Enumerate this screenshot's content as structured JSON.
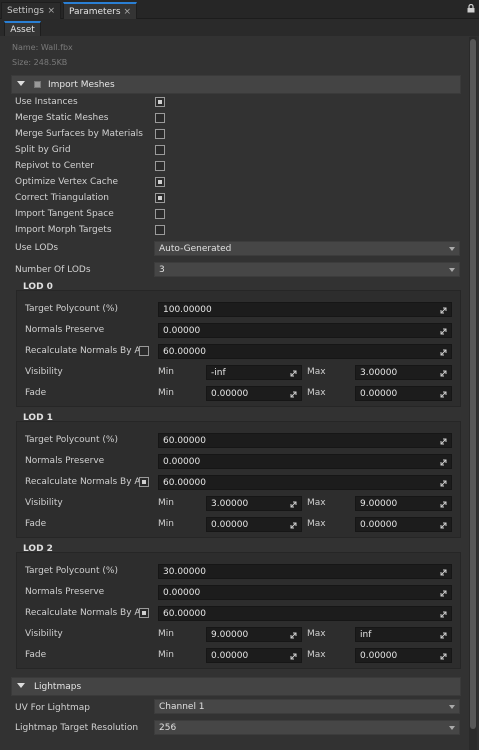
{
  "tabs": [
    {
      "label": "Settings",
      "close": "×"
    },
    {
      "label": "Parameters",
      "close": "×"
    }
  ],
  "subtab": "Asset",
  "asset": {
    "name": "Name: Wall.fbx",
    "size": "Size: 248.5KB"
  },
  "import_meshes": {
    "title": "Import Meshes",
    "options": [
      {
        "label": "Use Instances",
        "checked": true
      },
      {
        "label": "Merge Static Meshes",
        "checked": false
      },
      {
        "label": "Merge Surfaces by Materials",
        "checked": false
      },
      {
        "label": "Split by Grid",
        "checked": false
      },
      {
        "label": "Repivot to Center",
        "checked": false
      },
      {
        "label": "Optimize Vertex Cache",
        "checked": true
      },
      {
        "label": "Correct Triangulation",
        "checked": true
      },
      {
        "label": "Import Tangent Space",
        "checked": false
      },
      {
        "label": "Import Morph Targets",
        "checked": false
      }
    ],
    "use_lods": {
      "label": "Use LODs",
      "value": "Auto-Generated"
    },
    "num_lods": {
      "label": "Number Of LODs",
      "value": "3"
    }
  },
  "lod_labels": {
    "target": "Target Polycount (%)",
    "normals": "Normals Preserve",
    "recalc": "Recalculate Normals By A...",
    "visibility": "Visibility",
    "fade": "Fade",
    "min": "Min",
    "max": "Max"
  },
  "lods": [
    {
      "title": "LOD 0",
      "target": "100.00000",
      "normals": "0.00000",
      "recalc_checked": false,
      "recalc": "60.00000",
      "vis_min": "-inf",
      "vis_max": "3.00000",
      "fade_min": "0.00000",
      "fade_max": "0.00000"
    },
    {
      "title": "LOD 1",
      "target": "60.00000",
      "normals": "0.00000",
      "recalc_checked": true,
      "recalc": "60.00000",
      "vis_min": "3.00000",
      "vis_max": "9.00000",
      "fade_min": "0.00000",
      "fade_max": "0.00000"
    },
    {
      "title": "LOD 2",
      "target": "30.00000",
      "normals": "0.00000",
      "recalc_checked": true,
      "recalc": "60.00000",
      "vis_min": "9.00000",
      "vis_max": "inf",
      "fade_min": "0.00000",
      "fade_max": "0.00000"
    }
  ],
  "lightmaps": {
    "title": "Lightmaps",
    "uv": {
      "label": "UV For Lightmap",
      "value": "Channel 1"
    },
    "resolution": {
      "label": "Lightmap Target Resolution",
      "value": "256"
    }
  },
  "colors": {
    "accent": "#2a7fd4",
    "panel": "#323232",
    "field": "#1c1c1c",
    "section": "#444444"
  },
  "icons": {
    "lock": "lock-icon",
    "close": "close-icon",
    "collapse": "collapse-arrow-icon",
    "drag": "drag-handle-icon",
    "dropdown": "dropdown-arrow-icon"
  }
}
